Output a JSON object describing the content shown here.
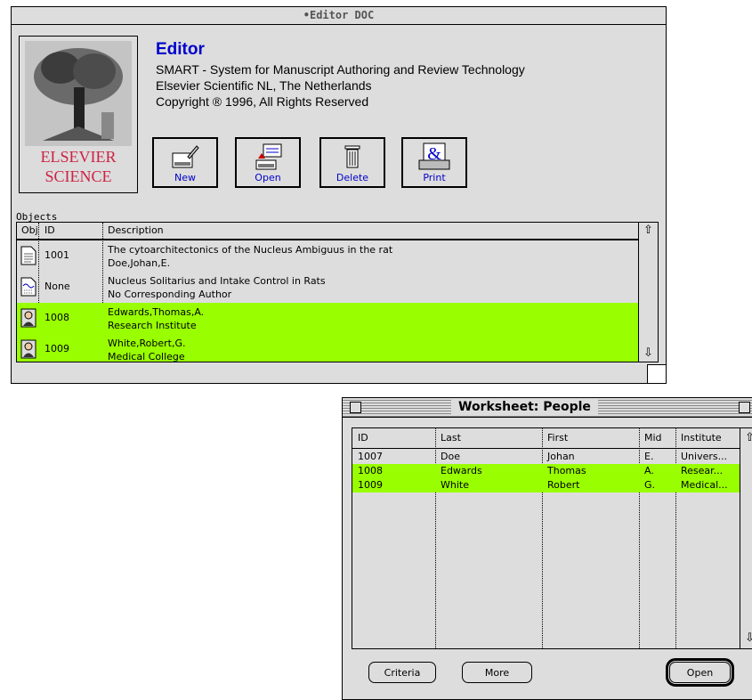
{
  "colors": {
    "highlight": "#99ff00",
    "window_bg": "#dddddd",
    "link_blue": "#0000cc",
    "logo_red": "#cc2244"
  },
  "editor": {
    "window_title": "•Editor DOC",
    "logo": {
      "line1": "ELSEVIER",
      "line2": "SCIENCE"
    },
    "app_name": "Editor",
    "info": [
      "SMART - System for Manuscript Authoring and Review Technology",
      "Elsevier Scientific NL, The Netherlands",
      "Copyright ® 1996, All Rights Reserved"
    ],
    "toolbar": [
      {
        "label": "New",
        "icon": "new-document-icon"
      },
      {
        "label": "Open",
        "icon": "open-document-icon"
      },
      {
        "label": "Delete",
        "icon": "trash-icon"
      },
      {
        "label": "Print",
        "icon": "print-icon"
      }
    ],
    "objects_label": "Objects",
    "columns": [
      "Obj",
      "ID",
      "Description"
    ],
    "rows": [
      {
        "icon": "document-icon",
        "id": "1001",
        "line1": "The cytoarchitectonics of the Nucleus Ambiguus in the rat",
        "line2": "Doe,Johan,E.",
        "highlighted": false
      },
      {
        "icon": "document-icon",
        "id": "None",
        "line1": "Nucleus Solitarius and Intake Control in Rats",
        "line2": "No Corresponding Author",
        "highlighted": false
      },
      {
        "icon": "person-icon",
        "id": "1008",
        "line1": "Edwards,Thomas,A.",
        "line2": "Research Institute",
        "highlighted": true
      },
      {
        "icon": "person-icon",
        "id": "1009",
        "line1": "White,Robert,G.",
        "line2": "Medical College",
        "highlighted": true
      }
    ]
  },
  "worksheet": {
    "title": "Worksheet: People",
    "columns": [
      "ID",
      "Last",
      "First",
      "Mid",
      "Institute"
    ],
    "rows": [
      {
        "id": "1007",
        "last": "Doe",
        "first": "Johan",
        "mid": "E.",
        "institute": "Univers...",
        "highlighted": false
      },
      {
        "id": "1008",
        "last": "Edwards",
        "first": "Thomas",
        "mid": "A.",
        "institute": "Resear...",
        "highlighted": true
      },
      {
        "id": "1009",
        "last": "White",
        "first": "Robert",
        "mid": "G.",
        "institute": "Medical...",
        "highlighted": true
      }
    ],
    "buttons": {
      "criteria": "Criteria",
      "more": "More",
      "open": "Open"
    }
  }
}
